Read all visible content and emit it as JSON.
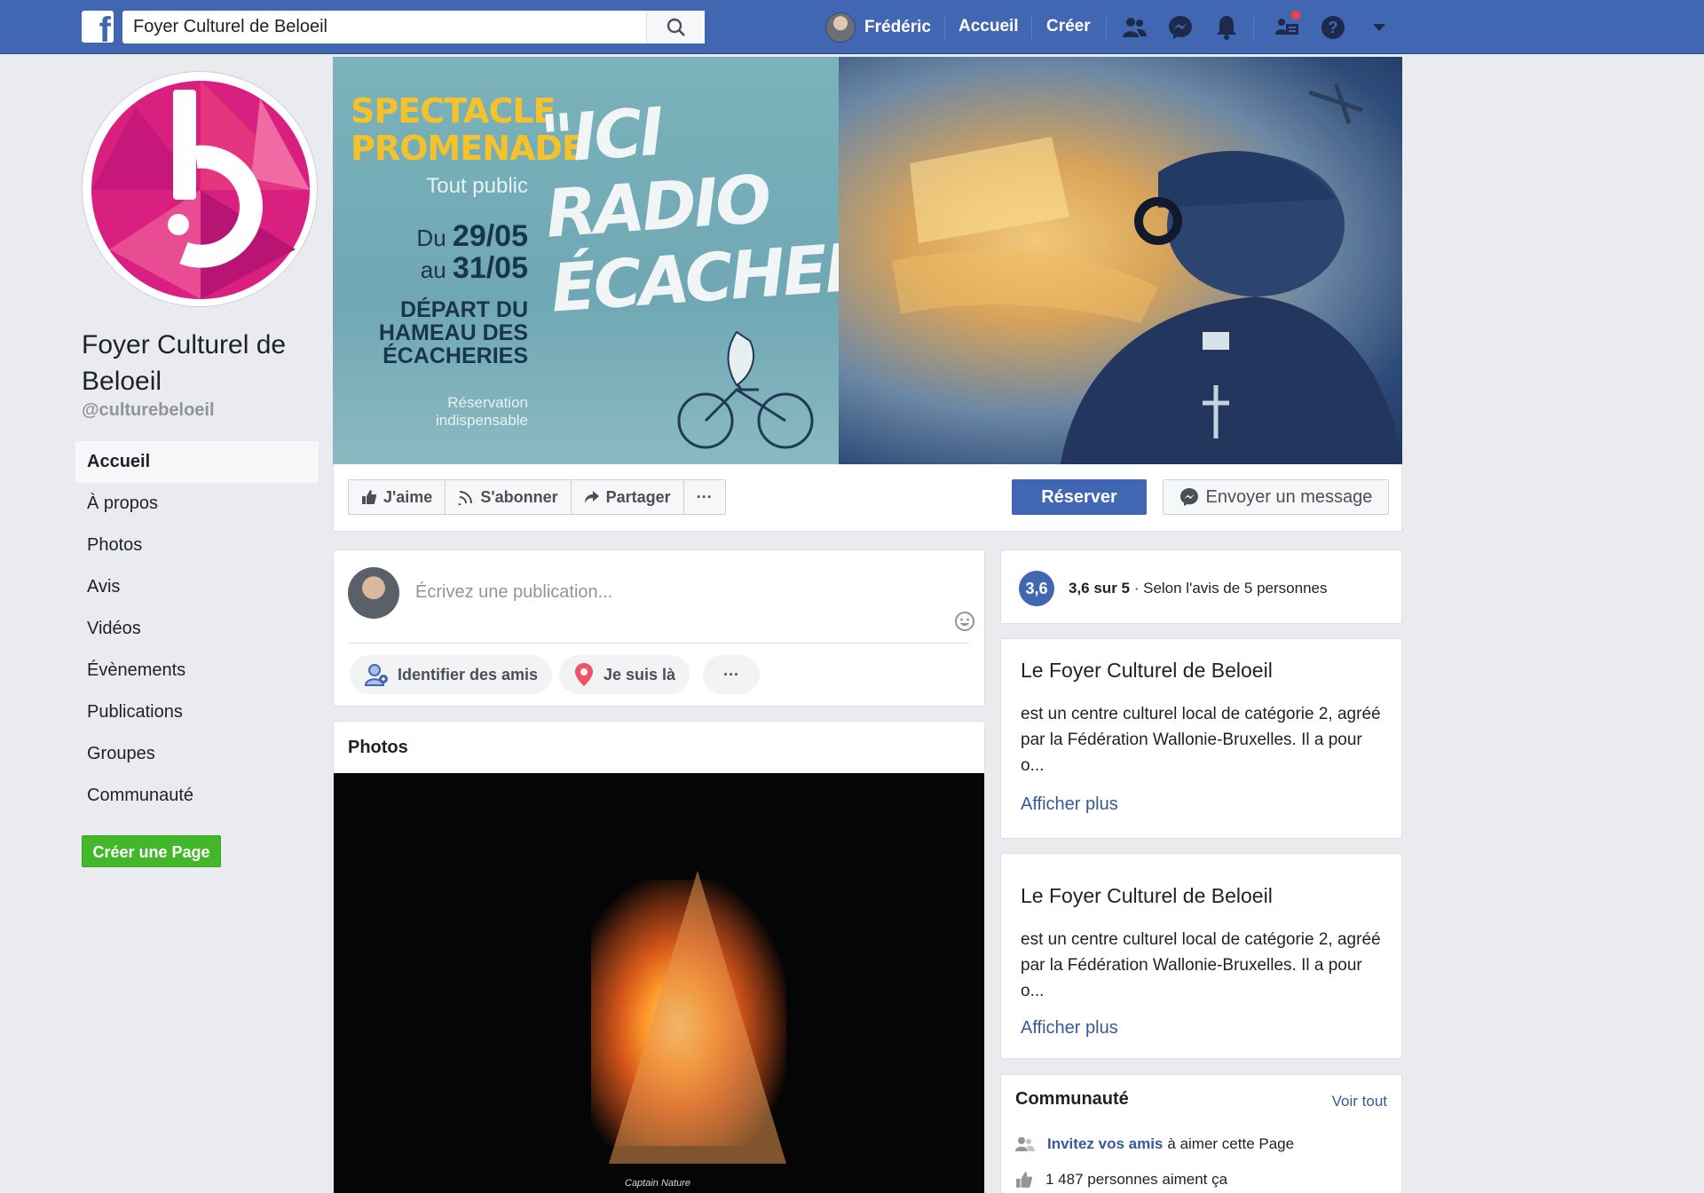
{
  "topbar": {
    "logo": "f",
    "search_value": "Foyer Culturel de Beloeil",
    "user_name": "Frédéric",
    "home_label": "Accueil",
    "create_label": "Créer",
    "icons": [
      "friends-icon",
      "messenger-icon",
      "notifications-icon",
      "groups-icon",
      "help-icon",
      "caret-down-icon"
    ],
    "brand_color": "#4267b2"
  },
  "page": {
    "name": "Foyer Culturel de Beloeil",
    "handle": "@culturebeloeil"
  },
  "left_nav": {
    "items": [
      {
        "label": "Accueil",
        "active": true
      },
      {
        "label": "À propos"
      },
      {
        "label": "Photos"
      },
      {
        "label": "Avis"
      },
      {
        "label": "Vidéos"
      },
      {
        "label": "Évènements"
      },
      {
        "label": "Publications"
      },
      {
        "label": "Groupes"
      },
      {
        "label": "Communauté"
      }
    ],
    "create_page": "Créer une Page"
  },
  "cover": {
    "line1": "SPECTACLE",
    "line2": "PROMENADE",
    "audience": "Tout public",
    "date_from_prefix": "Du",
    "date_from": "29/05",
    "date_to_prefix": "au",
    "date_to": "31/05",
    "depart": [
      "DÉPART DU",
      "HAMEAU DES",
      "ÉCACHERIES"
    ],
    "reservation": [
      "Réservation",
      "indispensable"
    ],
    "title_line1": "\"ICI RADIO",
    "title_line2": "ÉCACHERIES\""
  },
  "actions": {
    "like": "J'aime",
    "follow": "S'abonner",
    "share": "Partager",
    "more": "···",
    "reserve": "Réserver",
    "message": "Envoyer un message"
  },
  "composer": {
    "placeholder": "Écrivez une publication...",
    "tag_friends": "Identifier des amis",
    "checkin": "Je suis là",
    "more": "···"
  },
  "photos": {
    "title": "Photos",
    "credit": "Captain Nature"
  },
  "rating": {
    "score": "3,6",
    "summary_bold": "3,6 sur 5",
    "summary_rest": " · Selon l'avis de 5 personnes"
  },
  "about_cards": [
    {
      "title": "Le Foyer Culturel de Beloeil",
      "desc": "est un centre culturel local de catégorie 2, agréé par la Fédération Wallonie-Bruxelles. Il a pour o...",
      "more": "Afficher plus"
    },
    {
      "title": "Le Foyer Culturel de Beloeil",
      "desc": "est un centre culturel local de catégorie 2, agréé par la Fédération Wallonie-Bruxelles. Il a pour o...",
      "more": "Afficher plus"
    }
  ],
  "community": {
    "title": "Communauté",
    "see_all": "Voir tout",
    "invite_link": "Invitez vos amis",
    "invite_rest": "à aimer cette Page",
    "likes": "1 487 personnes aiment ça"
  }
}
